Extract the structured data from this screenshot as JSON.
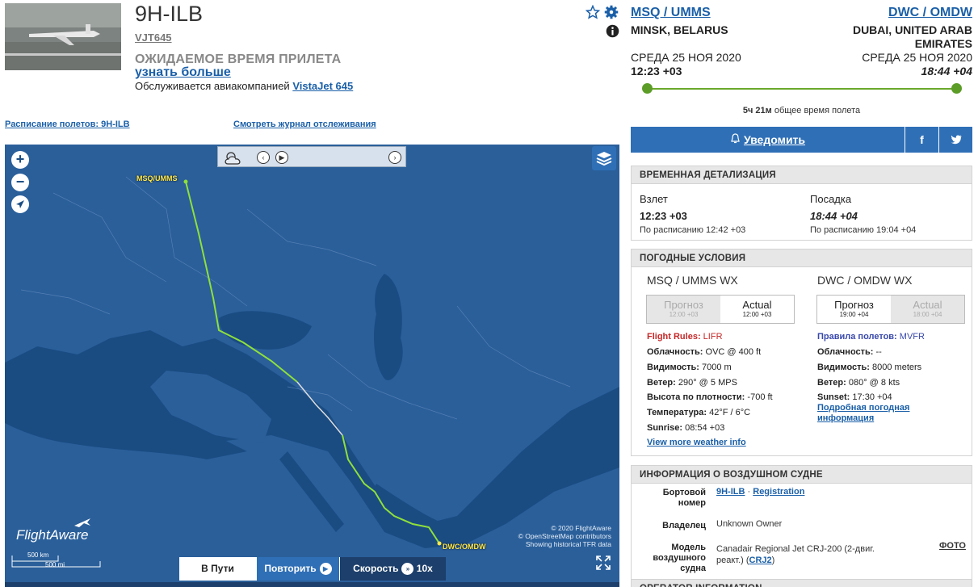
{
  "header": {
    "registration": "9H-ILB",
    "callsign": "VJT645",
    "eta_label": "ОЖИДАЕМОЕ ВРЕМЯ ПРИЛЕТА",
    "learn_more": "узнать больше",
    "operated_prefix": "Обслуживается авиакомпанией",
    "operated_link": "VistaJet 645",
    "schedule_link": "Расписание полетов: 9H-ILB",
    "track_log_link": "Смотреть журнал отслеживания"
  },
  "route": {
    "origin": {
      "code": "MSQ / UMMS",
      "city": "MINSK, BELARUS",
      "date": "СРЕДА 25 НОЯ 2020",
      "time": "12:23 +03"
    },
    "destination": {
      "code": "DWC / OMDW",
      "city_line1": "DUBAI, UNITED ARAB",
      "city_line2": "EMIRATES",
      "date": "СРЕДА 25 НОЯ 2020",
      "time": "18:44 +04"
    },
    "total_time_bold": "5ч 21м",
    "total_time_rest": "общее время полета",
    "progress": 1.0
  },
  "actions": {
    "notify": "Уведомить",
    "facebook": "f",
    "twitter": "t"
  },
  "times": {
    "title": "ВРЕМЕННАЯ ДЕТАЛИЗАЦИЯ",
    "takeoff_label": "Взлет",
    "takeoff_time": "12:23 +03",
    "takeoff_sched": "По расписанию 12:42 +03",
    "landing_label": "Посадка",
    "landing_time": "18:44 +04",
    "landing_sched": "По расписанию 19:04 +04"
  },
  "weather": {
    "title": "ПОГОДНЫЕ УСЛОВИЯ",
    "origin": {
      "title": "MSQ / UMMS WX",
      "forecast_label": "Прогноз",
      "forecast_time": "12:00 +03",
      "actual_label": "Actual",
      "actual_time": "12:00 +03",
      "rules_label": "Flight Rules:",
      "rules_value": "LIFR",
      "cloud_label": "Облачность:",
      "cloud_value": "OVC @ 400 ft",
      "vis_label": "Видимость:",
      "vis_value": "7000 m",
      "wind_label": "Ветер:",
      "wind_value": "290° @ 5 MPS",
      "density_label": "Высота по плотности:",
      "density_value": "-700 ft",
      "temp_label": "Температура:",
      "temp_value": "42°F / 6°C",
      "sunrise_label": "Sunrise:",
      "sunrise_value": "08:54 +03",
      "more_link": "View more weather info"
    },
    "destination": {
      "title": "DWC / OMDW WX",
      "forecast_label": "Прогноз",
      "forecast_time": "19:00 +04",
      "actual_label": "Actual",
      "actual_time": "18:00 +04",
      "rules_label": "Правила полетов:",
      "rules_value": "MVFR",
      "cloud_label": "Облачность:",
      "cloud_value": "--",
      "vis_label": "Видимость:",
      "vis_value": "8000 meters",
      "wind_label": "Ветер:",
      "wind_value": "080° @ 8 kts",
      "sunset_label": "Sunset:",
      "sunset_value": "17:30 +04",
      "more_link_line1": "Подробная погодная",
      "more_link_line2": "информация"
    }
  },
  "aircraft": {
    "title": "ИНФОРМАЦИЯ О ВОЗДУШНОМ СУДНЕ",
    "tail_label_1": "Бортовой",
    "tail_label_2": "номер",
    "tail_value": "9H-ILB",
    "tail_sep": "·",
    "registration_link": "Registration",
    "owner_label": "Владелец",
    "owner_value": "Unknown Owner",
    "model_label_1": "Модель",
    "model_label_2": "воздушного",
    "model_label_3": "судна",
    "model_value_1": "Canadair Regional Jet CRJ-200 (2-двиг.",
    "model_value_2": "реакт.) (",
    "model_code": "CRJ2",
    "model_value_end": ")",
    "photo_link": "ФОТО"
  },
  "operator": {
    "title": "OPERATOR INFORMATION"
  },
  "map": {
    "origin_label": "MSQ/UMMS",
    "dest_label": "DWC/OMDW",
    "brand": "FlightAware",
    "copyright_1": "© 2020 FlightAware",
    "copyright_2": "© OpenStreetMap contributors",
    "copyright_3": "Showing historical TFR data",
    "scale_km": "500 km",
    "scale_mi": "500 mi",
    "status": "В Пути",
    "replay": "Повторить",
    "speed": "Скорость",
    "speed_value": "10x"
  },
  "colors": {
    "accent": "#2f6fb6",
    "map_sea": "#1a4c82",
    "map_land": "#2a5f9a",
    "track": "#8fe03a"
  }
}
